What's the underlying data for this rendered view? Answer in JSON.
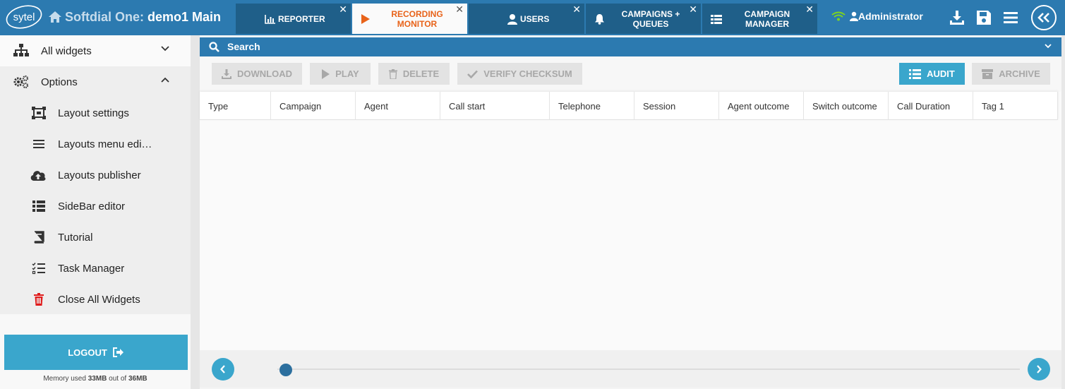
{
  "header": {
    "logo_text": "sytel",
    "brand": "Softdial One:",
    "layout_name": "demo1 Main",
    "user": "Administrator",
    "colors": {
      "bar": "#2c7ab0",
      "tab": "#1f5f89",
      "active_tab_text": "#e8631a",
      "connection": "#7ed321"
    }
  },
  "tabs": [
    {
      "label": "REPORTER",
      "icon": "bar-chart-icon",
      "active": false,
      "close": "✕"
    },
    {
      "label": "RECORDING MONITOR",
      "icon": "play-icon",
      "active": true,
      "close": "✕"
    },
    {
      "label": "USERS",
      "icon": "user-icon",
      "active": false,
      "close": "✕"
    },
    {
      "label": "CAMPAIGNS + QUEUES",
      "icon": "bell-icon",
      "active": false,
      "close": "✕"
    },
    {
      "label": "CAMPAIGN MANAGER",
      "icon": "grid-list-icon",
      "active": false,
      "close": "✕"
    }
  ],
  "sidebar": {
    "sections": [
      {
        "label": "All widgets",
        "icon": "sitemap-icon",
        "expanded": false
      },
      {
        "label": "Options",
        "icon": "cogs-icon",
        "expanded": true
      }
    ],
    "items": [
      {
        "label": "Layout settings",
        "icon": "layout-settings-icon"
      },
      {
        "label": "Layouts menu edi…",
        "icon": "menu-lines-icon"
      },
      {
        "label": "Layouts publisher",
        "icon": "cloud-upload-icon"
      },
      {
        "label": "SideBar editor",
        "icon": "list-icon"
      },
      {
        "label": "Tutorial",
        "icon": "book-icon"
      },
      {
        "label": "Task Manager",
        "icon": "task-list-icon"
      },
      {
        "label": "Close All Widgets",
        "icon": "trash-icon"
      }
    ],
    "logout_label": "LOGOUT",
    "memory": {
      "prefix": "Memory used",
      "used": "33MB",
      "middle": "out of",
      "total": "36MB"
    }
  },
  "search": {
    "label": "Search"
  },
  "toolbar": {
    "download": "DOWNLOAD",
    "play": "PLAY",
    "delete": "DELETE",
    "verify": "VERIFY CHECKSUM",
    "audit": "AUDIT",
    "archive": "ARCHIVE"
  },
  "table": {
    "columns": [
      "Type",
      "Campaign",
      "Agent",
      "Call start",
      "Telephone",
      "Session",
      "Agent outcome",
      "Switch outcome",
      "Call Duration",
      "Tag 1"
    ],
    "rows": []
  },
  "pager": {
    "position": 0
  }
}
